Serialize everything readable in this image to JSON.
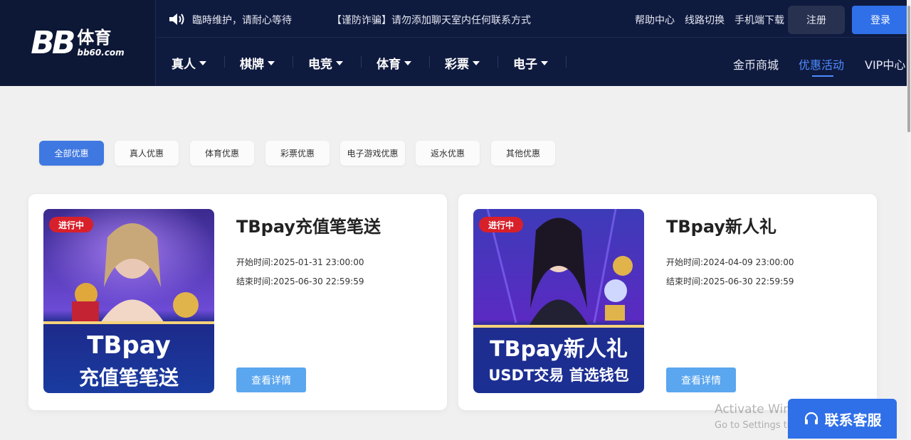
{
  "logo": {
    "mark": "BB",
    "cn": "体育",
    "domain": "bb60.com"
  },
  "topbar": {
    "notice1": "臨時维护，请耐心等待",
    "notice2": "【谨防诈骗】请勿添加聊天室内任何联系方式",
    "links": [
      "帮助中心",
      "线路切换",
      "手机端下载"
    ],
    "register": "注册",
    "login": "登录"
  },
  "nav": {
    "items": [
      "真人",
      "棋牌",
      "电竞",
      "体育",
      "彩票",
      "电子"
    ],
    "right": [
      "金币商城",
      "优惠活动",
      "VIP中心"
    ]
  },
  "tabs": [
    "全部优惠",
    "真人优惠",
    "体育优惠",
    "彩票优惠",
    "电子游戏优惠",
    "返水优惠",
    "其他优惠"
  ],
  "cards": [
    {
      "badge": "进行中",
      "title": "TBpay充值笔笔送",
      "start_label": "开始时间:",
      "start": "2025-01-31 23:00:00",
      "end_label": "结束时间:",
      "end": "2025-06-30 22:59:59",
      "img_line1": "TBpay",
      "img_line2": "充值笔笔送",
      "button": "查看详情"
    },
    {
      "badge": "进行中",
      "title": "TBpay新人礼",
      "start_label": "开始时间:",
      "start": "2024-04-09 23:00:00",
      "end_label": "结束时间:",
      "end": "2025-06-30 22:59:59",
      "img_line1": "TBpay新人礼",
      "img_line2": "USDT交易 首选钱包",
      "button": "查看详情"
    }
  ],
  "service": {
    "label": "联系客服"
  },
  "watermark": {
    "line1": "Activate Windows",
    "line2": "Go to Settings to activate Windows."
  },
  "colors": {
    "header": "#0f1a3f",
    "accent": "#2f6fe8",
    "active_link": "#4d8dff",
    "badge": "#d8202a",
    "detail_button": "#5aa6ef"
  }
}
